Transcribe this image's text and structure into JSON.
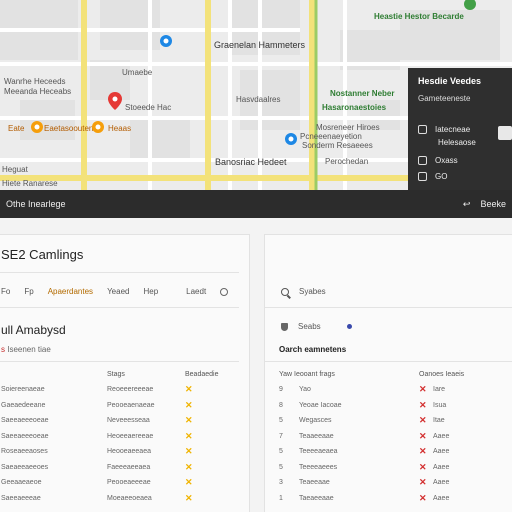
{
  "map": {
    "labels": {
      "top_right_green": "Heastie Hestor Becarde",
      "district": "Graenelan Hammeters",
      "area_left": "Wanrhe Heceeds",
      "area_left2": "Meeanda Heceabs",
      "street_mid": "Umaebe",
      "pin_red": "Stoeede Hac",
      "orange_left": "Eate",
      "orange_mid": "Eaetasooutens",
      "orange_right": "Heaas",
      "mid_label": "Hasvdaalres",
      "green_mid1": "Nostanner Neber",
      "green_mid2": "Hasaronaestoies",
      "block1": "Mosreneer Hiroes",
      "block2": "Pcneeenaeyetion",
      "block3": "Sonderm Resaeees",
      "left_small": "Heguat",
      "left_small2": "Hiete Ranarese",
      "bottom_label": "Banosriac Hedeet",
      "bottom_right": "Perochedan"
    },
    "panel": {
      "title": "Hesdie Veedes",
      "subtitle": "Gameteeneste",
      "rows": [
        "Iatecneae",
        "Helesaose",
        "Oxass",
        "GO"
      ]
    }
  },
  "darkbar": {
    "left": "Othe Inearlege",
    "right_icon": "↩",
    "right_label": "Beeke"
  },
  "left_card": {
    "title": "SE2 Camlings",
    "tabs": [
      "Fo",
      "Fp",
      "Apaerdantes",
      "Yeaed",
      "Hep",
      "Laedt"
    ],
    "section": "ull Amabysd",
    "meta_red": "s",
    "meta_rest": "Iseenen tiae",
    "table_headers": [
      "",
      "Stags",
      "Beadaedie"
    ],
    "rows": [
      [
        "Soiereenaeae",
        "Reoeeereeeae"
      ],
      [
        "Gaeaedeeane",
        "Peooeaenaeae"
      ],
      [
        "Saeeaeeeoeae",
        "Neveeesseaa"
      ],
      [
        "Saeeaeeeoeae",
        "Heoeeaereeae"
      ],
      [
        "Roseaeeaoses",
        "Heooeaeeaea"
      ],
      [
        "Saeaeeaeeoes",
        "Faeeeaeeaea"
      ],
      [
        "Geeaaeaeoe",
        "Peooeaeeeae"
      ],
      [
        "Saeeaeeeae",
        "Moeaeeoeaea"
      ]
    ]
  },
  "right_card": {
    "search_label": "Syabes",
    "status_label": "Seabs",
    "subhead": "Oarch eamnetens",
    "table_headers": [
      "Yaw Ieooant frags",
      "Oanoes Ieaeis"
    ],
    "rows": [
      [
        "9",
        "Yao",
        "Iare"
      ],
      [
        "8",
        "Yeoae Iacoae",
        "Isua"
      ],
      [
        "5",
        "Wegasces",
        "Itae"
      ],
      [
        "7",
        "Teaaeeaae",
        "Aaee"
      ],
      [
        "5",
        "Teeeeaeaea",
        "Aaee"
      ],
      [
        "5",
        "Teeeeaeees",
        "Aaee"
      ],
      [
        "3",
        "Teaeeaae",
        "Aaee"
      ],
      [
        "1",
        "Taeaeeaae",
        "Aaee"
      ]
    ]
  },
  "colors": {
    "map_bg": "#ececec",
    "dark": "#2c2c2c",
    "accent_orange": "#b36b00",
    "check_yellow": "#f0b400",
    "cross_red": "#d32f2f"
  }
}
